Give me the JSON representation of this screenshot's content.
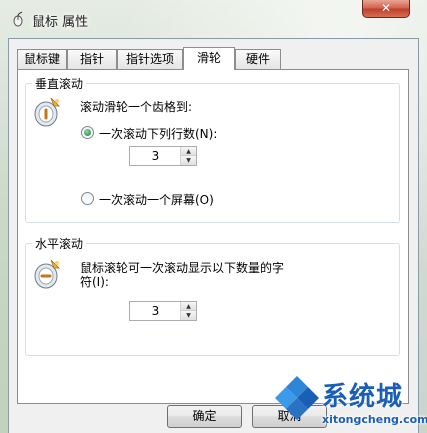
{
  "window": {
    "title": "鼠标 属性",
    "close_label": "✕"
  },
  "tabs": [
    {
      "label": "鼠标键"
    },
    {
      "label": "指针"
    },
    {
      "label": "指针选项"
    },
    {
      "label": "滑轮"
    },
    {
      "label": "硬件"
    }
  ],
  "vertical": {
    "title": "垂直滚动",
    "prompt": "滚动滑轮一个齿格到:",
    "option_lines_label": "一次滚动下列行数(N):",
    "lines_value": "3",
    "option_screen_label": "一次滚动一个屏幕(O)"
  },
  "horizontal": {
    "title": "水平滚动",
    "prompt_line1": "鼠标滚轮可一次滚动显示以下数量的字",
    "prompt_line2": "符(I):",
    "chars_value": "3"
  },
  "buttons": {
    "ok": "确定",
    "cancel": "取消"
  },
  "watermark": {
    "brand": "系统城",
    "url": "xitongcheng.com"
  },
  "colors": {
    "accent": "#1a5fb4",
    "close": "#c0402a"
  }
}
